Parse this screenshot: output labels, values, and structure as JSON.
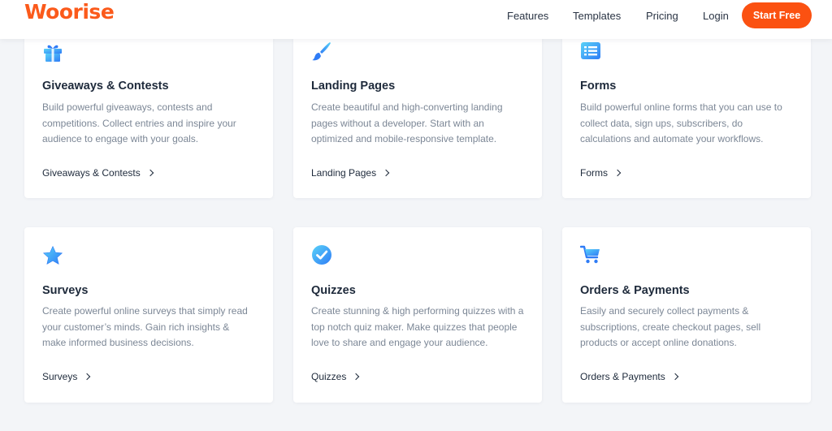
{
  "brand": {
    "logo": "Woorise",
    "accent": "#fb5111"
  },
  "nav": {
    "features": "Features",
    "templates": "Templates",
    "pricing": "Pricing",
    "login": "Login",
    "cta": "Start Free"
  },
  "cards": [
    {
      "icon": "gift-icon",
      "title": "Giveaways & Contests",
      "description": "Build powerful giveaways, contests and competitions. Collect entries and inspire your audience to engage with your goals.",
      "link": "Giveaways & Contests"
    },
    {
      "icon": "paintbrush-icon",
      "title": "Landing Pages",
      "description": "Create beautiful and high-converting landing pages without a developer. Start with an optimized and mobile-responsive template.",
      "link": "Landing Pages"
    },
    {
      "icon": "list-form-icon",
      "title": "Forms",
      "description": "Build powerful online forms that you can use to collect data, sign ups, subscribers, do calculations and automate your workflows.",
      "link": "Forms"
    },
    {
      "icon": "star-icon",
      "title": "Surveys",
      "description": "Create powerful online surveys that simply read your customer’s minds. Gain rich insights & make informed business decisions.",
      "link": "Surveys"
    },
    {
      "icon": "check-circle-icon",
      "title": "Quizzes",
      "description": "Create stunning & high performing quizzes with a top notch quiz maker. Make quizzes that people love to share and engage your audience.",
      "link": "Quizzes"
    },
    {
      "icon": "shopping-cart-icon",
      "title": "Orders & Payments",
      "description": "Easily and securely collect payments & subscriptions, create checkout pages, sell products or accept online donations.",
      "link": "Orders & Payments"
    }
  ]
}
